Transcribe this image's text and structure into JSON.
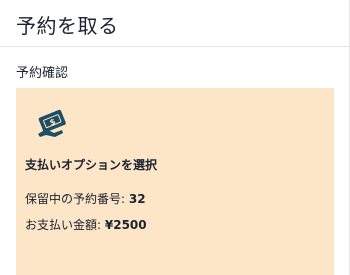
{
  "header": {
    "title": "予約を取る"
  },
  "section": {
    "title": "予約確認"
  },
  "card": {
    "icon": "payment-card-icon",
    "option_title": "支払いオプションを選択",
    "reservation_label": "保留中の予約番号:",
    "reservation_number": "32",
    "amount_label": "お支払い金額:",
    "amount_value": "¥2500"
  },
  "colors": {
    "card_background": "#fde5c8",
    "icon": "#1d4e63",
    "text": "#1c2330"
  }
}
